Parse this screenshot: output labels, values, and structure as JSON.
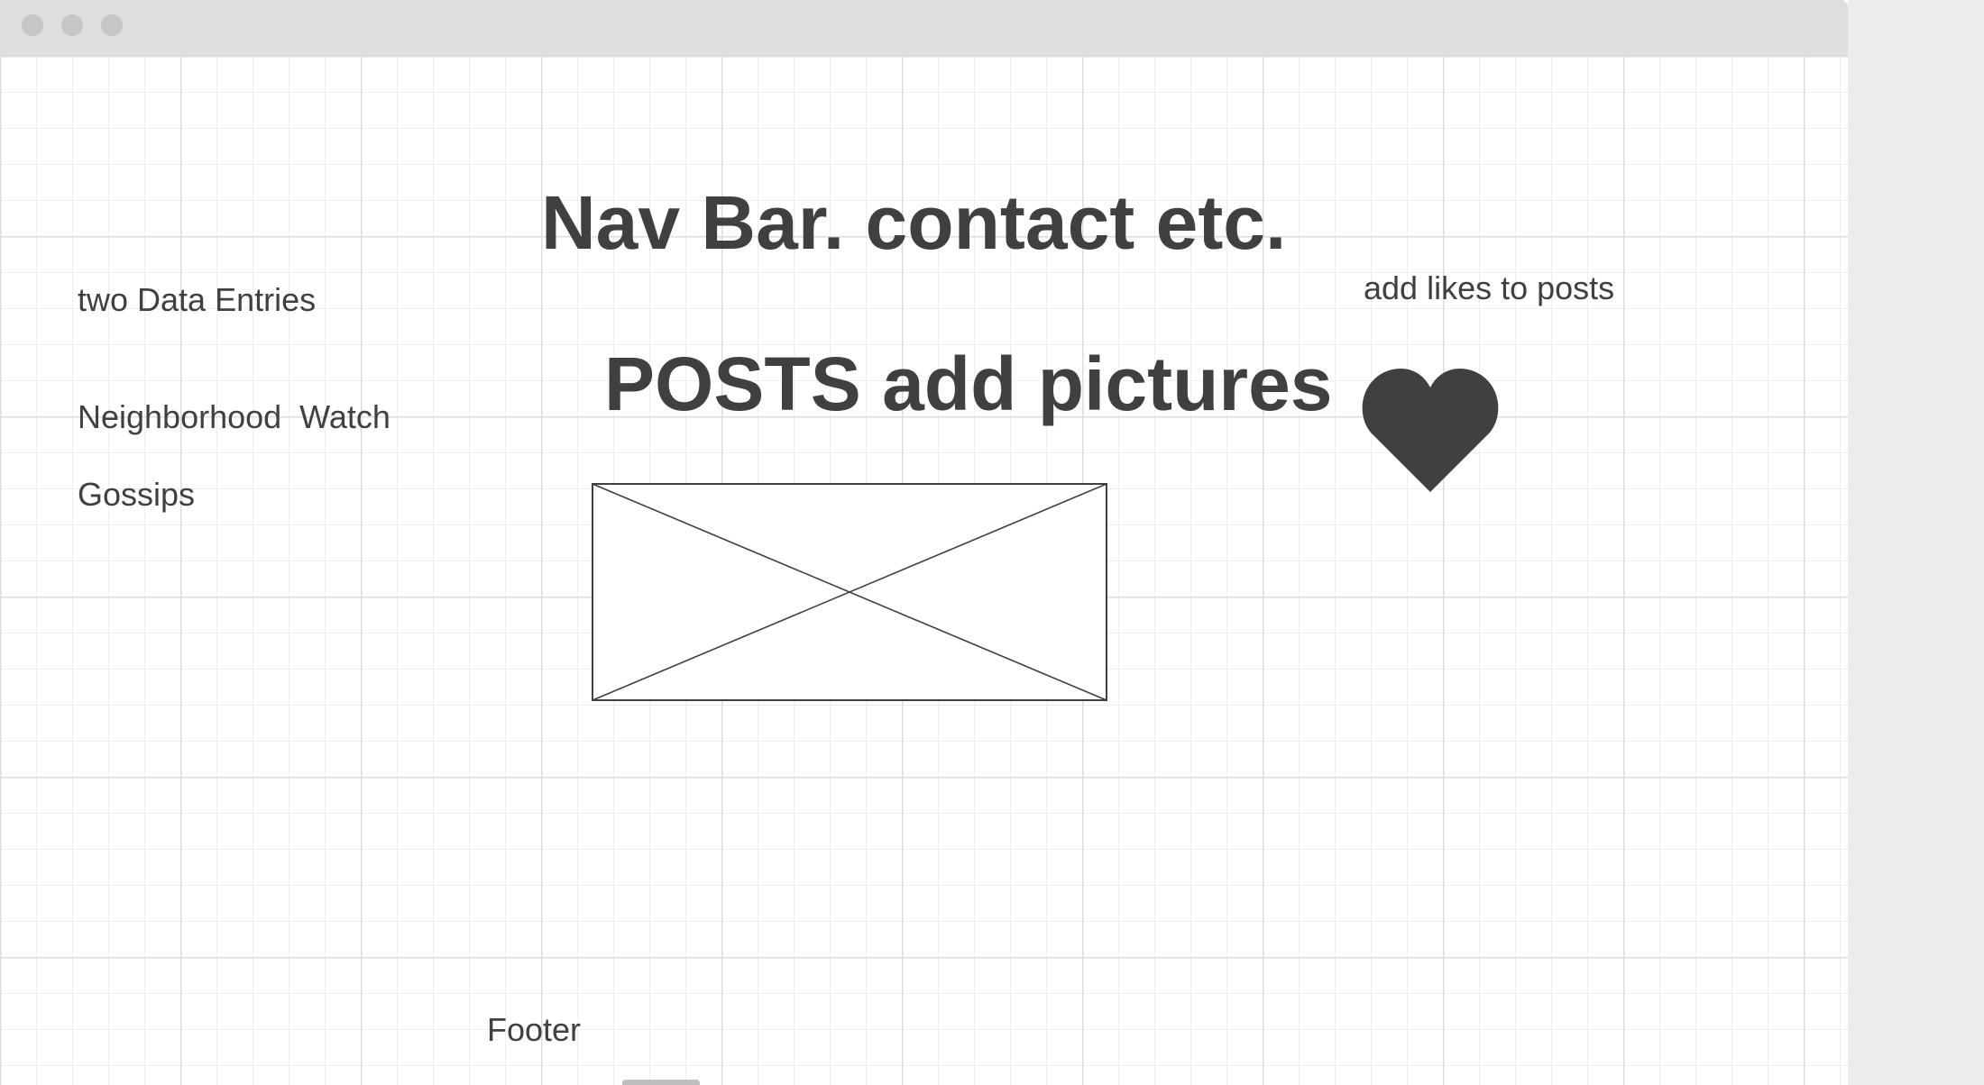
{
  "wireframe": {
    "nav_title": "Nav Bar. contact etc.",
    "posts_title": "POSTS add pictures",
    "sidebar": {
      "entries_label": "two Data Entries",
      "neighborhood_label": "Neighborhood  Watch",
      "gossips_label": "Gossips"
    },
    "likes_note": "add likes to posts",
    "footer_label": "Footer"
  },
  "icons": {
    "heart": "heart-icon",
    "image": "image-placeholder-icon"
  },
  "colors": {
    "text": "#404040",
    "grid_major": "#dcdcdc",
    "grid_minor": "#efefef",
    "titlebar": "#dedede"
  }
}
